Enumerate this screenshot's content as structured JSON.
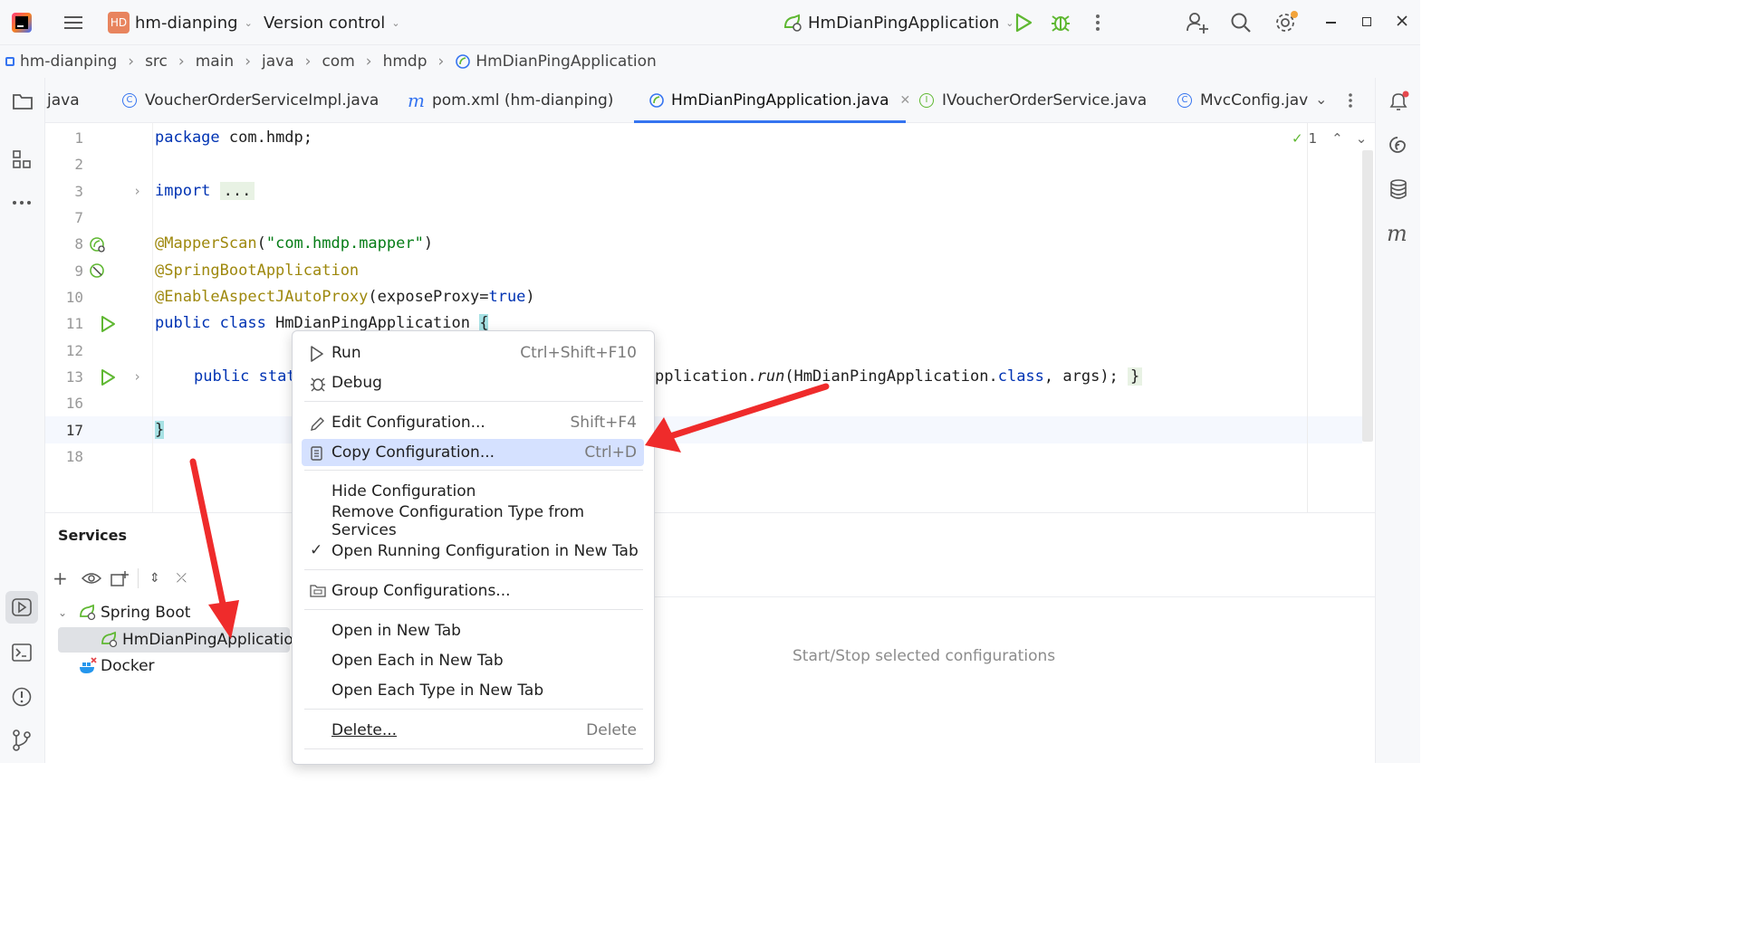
{
  "titlebar": {
    "project_badge": "HD",
    "project_name": "hm-dianping",
    "vcs_label": "Version control",
    "run_config": "HmDianPingApplication"
  },
  "breadcrumb": [
    "hm-dianping",
    "src",
    "main",
    "java",
    "com",
    "hmdp",
    "HmDianPingApplication"
  ],
  "tabs": [
    {
      "label": "java"
    },
    {
      "label": "VoucherOrderServiceImpl.java"
    },
    {
      "label": "pom.xml (hm-dianping)"
    },
    {
      "label": "HmDianPingApplication.java",
      "active": true
    },
    {
      "label": "IVoucherOrderService.java"
    },
    {
      "label": "MvcConfig.jav"
    }
  ],
  "editor": {
    "inspection_count": "1",
    "lines": [
      {
        "num": "1"
      },
      {
        "num": "2"
      },
      {
        "num": "3"
      },
      {
        "num": "7"
      },
      {
        "num": "8"
      },
      {
        "num": "9"
      },
      {
        "num": "10"
      },
      {
        "num": "11"
      },
      {
        "num": "12"
      },
      {
        "num": "13"
      },
      {
        "num": "16"
      },
      {
        "num": "17"
      },
      {
        "num": "18"
      }
    ],
    "code": {
      "l1_kw": "package",
      "l1_rest": " com.hmdp;",
      "l3_kw": "import",
      "l3_fold": "...",
      "l8_ann": "@MapperScan",
      "l8_open": "(",
      "l8_str": "\"com.hmdp.mapper\"",
      "l8_close": ")",
      "l9_ann": "@SpringBootApplication",
      "l10_ann": "@EnableAspectJAutoProxy",
      "l10_mid": "(exposeProxy=",
      "l10_kw": "true",
      "l10_close": ")",
      "l11_kw": "public class",
      "l11_name": " HmDianPingApplication ",
      "l11_brace": "{",
      "l13_kw": "public stat",
      "l13_tail_a": "pplication.",
      "l13_run": "run",
      "l13_tail_b": "(HmDianPingApplication.",
      "l13_class": "class",
      "l13_tail_c": ", args); ",
      "l13_brace": "}",
      "l17_brace": "}"
    }
  },
  "services": {
    "title": "Services",
    "tree": {
      "group": "Spring Boot",
      "item": "HmDianPingApplication",
      "docker": "Docker"
    },
    "empty_hint": "Start/Stop selected configurations"
  },
  "context_menu": {
    "items": [
      {
        "label": "Run",
        "shortcut": "Ctrl+Shift+F10"
      },
      {
        "label": "Debug",
        "shortcut": ""
      },
      {
        "label": "Edit Configuration...",
        "shortcut": "Shift+F4"
      },
      {
        "label": "Copy Configuration...",
        "shortcut": "Ctrl+D",
        "highlighted": true
      },
      {
        "label": "Hide Configuration",
        "shortcut": ""
      },
      {
        "label": "Remove Configuration Type from Services",
        "shortcut": ""
      },
      {
        "label": "Open Running Configuration in New Tab",
        "shortcut": "",
        "checked": true
      },
      {
        "label": "Group Configurations...",
        "shortcut": ""
      },
      {
        "label": "Open in New Tab",
        "shortcut": ""
      },
      {
        "label": "Open Each in New Tab",
        "shortcut": ""
      },
      {
        "label": "Open Each Type in New Tab",
        "shortcut": ""
      },
      {
        "label": "Delete...",
        "shortcut": "Delete"
      }
    ]
  },
  "colors": {
    "accent_blue": "#3574f0",
    "run_green": "#5fb832",
    "annotation_arrow_red": "#ef2b2b",
    "highlight_bg": "#d5e1ff"
  }
}
